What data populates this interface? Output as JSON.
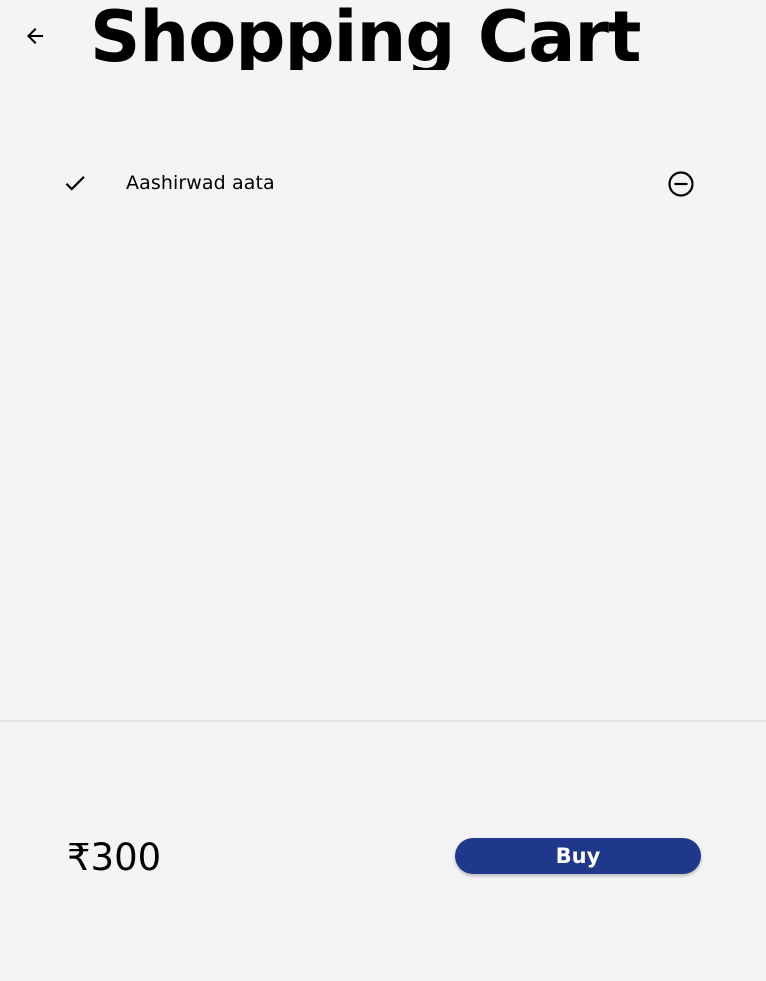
{
  "header": {
    "title": "Shopping Cart",
    "back_icon": "arrow-back-icon"
  },
  "cart": {
    "items": [
      {
        "name": "Aashirwad aata",
        "checked": true,
        "check_icon": "check-icon",
        "remove_icon": "remove-circle-icon"
      }
    ]
  },
  "footer": {
    "total": "₹300",
    "buy_label": "Buy"
  },
  "colors": {
    "background": "#f4f4f4",
    "accent": "#1f388b",
    "divider": "#e2e2e2"
  }
}
